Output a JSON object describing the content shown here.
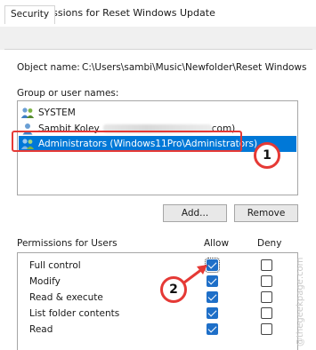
{
  "window": {
    "title": "Permissions for Reset Windows Update",
    "tabs": [
      {
        "label": "Security",
        "active": true
      }
    ]
  },
  "object": {
    "label": "Object name:",
    "value": "C:\\Users\\sambi\\Music\\Newfolder\\Reset Windows"
  },
  "groups": {
    "label": "Group or user names:",
    "items": [
      {
        "label": "SYSTEM",
        "icon": "user-group-icon",
        "selected": false
      },
      {
        "label_prefix": "Sambit Koley",
        "label_suffix": "com)",
        "icon": "user-icon",
        "selected": false
      },
      {
        "label": "Administrators (Windows11Pro\\Administrators)",
        "icon": "user-group-icon",
        "selected": true
      }
    ]
  },
  "buttons": {
    "add": "Add...",
    "remove": "Remove"
  },
  "permissions": {
    "header": "Permissions for Users",
    "allow_label": "Allow",
    "deny_label": "Deny",
    "rows": [
      {
        "name": "Full control",
        "allow": true,
        "deny": false
      },
      {
        "name": "Modify",
        "allow": true,
        "deny": false
      },
      {
        "name": "Read & execute",
        "allow": true,
        "deny": false
      },
      {
        "name": "List folder contents",
        "allow": true,
        "deny": false
      },
      {
        "name": "Read",
        "allow": true,
        "deny": false
      }
    ]
  },
  "annotations": {
    "badge1": "1",
    "badge2": "2",
    "color": "#e53935"
  },
  "watermark": "@thegeekpage.com",
  "colors": {
    "selection": "#0078d7",
    "checkbox": "#1e6fc8"
  }
}
